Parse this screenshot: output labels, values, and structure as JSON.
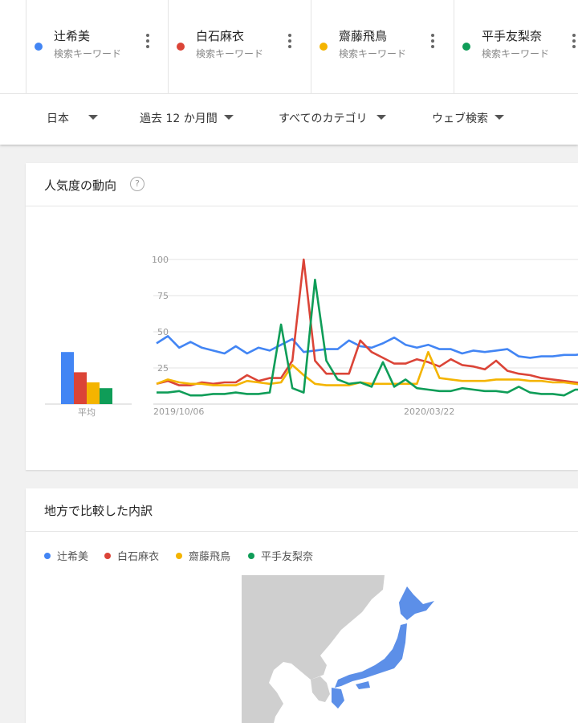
{
  "terms": [
    {
      "name": "辻希美",
      "sub": "検索キーワード",
      "color": "#4285f4"
    },
    {
      "name": "白石麻衣",
      "sub": "検索キーワード",
      "color": "#db4437"
    },
    {
      "name": "齋藤飛鳥",
      "sub": "検索キーワード",
      "color": "#f4b400"
    },
    {
      "name": "平手友梨奈",
      "sub": "検索キーワード",
      "color": "#0f9d58"
    }
  ],
  "filters": {
    "region": "日本",
    "period": "過去 12 か月間",
    "category": "すべてのカテゴリ",
    "search_type": "ウェブ検索"
  },
  "trend_card": {
    "title": "人気度の動向",
    "help_icon": "help-icon",
    "average_label": "平均"
  },
  "region_card": {
    "title": "地方で比較した内訳"
  },
  "chart_data": [
    {
      "type": "bar",
      "xlabel": "平均",
      "categories": [
        "辻希美",
        "白石麻衣",
        "齋藤飛鳥",
        "平手友梨奈"
      ],
      "values": [
        36,
        22,
        15,
        11
      ],
      "colors": [
        "#4285f4",
        "#db4437",
        "#f4b400",
        "#0f9d58"
      ]
    },
    {
      "type": "line",
      "ylim": [
        0,
        100
      ],
      "yticks": [
        25,
        50,
        75,
        100
      ],
      "xtick_labels": [
        "2019/10/06",
        "2020/03/22"
      ],
      "grid": true,
      "series": [
        {
          "name": "辻希美",
          "color": "#4285f4",
          "values": [
            42,
            47,
            39,
            43,
            39,
            37,
            35,
            40,
            35,
            39,
            37,
            41,
            45,
            36,
            37,
            38,
            38,
            44,
            40,
            39,
            42,
            46,
            41,
            39,
            41,
            38,
            38,
            35,
            37,
            36,
            37,
            38,
            33,
            32,
            33,
            33,
            34,
            34,
            35
          ]
        },
        {
          "name": "白石麻衣",
          "color": "#db4437",
          "values": [
            14,
            16,
            13,
            13,
            15,
            14,
            15,
            15,
            20,
            16,
            18,
            18,
            30,
            100,
            30,
            21,
            21,
            21,
            44,
            36,
            32,
            28,
            28,
            31,
            29,
            26,
            31,
            27,
            26,
            24,
            30,
            23,
            21,
            20,
            18,
            17,
            16,
            15,
            14
          ]
        },
        {
          "name": "齋藤飛鳥",
          "color": "#f4b400",
          "values": [
            14,
            17,
            15,
            14,
            14,
            13,
            13,
            13,
            16,
            15,
            14,
            15,
            27,
            20,
            14,
            13,
            13,
            13,
            15,
            14,
            14,
            14,
            14,
            14,
            36,
            18,
            17,
            16,
            16,
            16,
            17,
            17,
            17,
            16,
            16,
            15,
            15,
            14,
            13
          ]
        },
        {
          "name": "平手友梨奈",
          "color": "#0f9d58",
          "values": [
            8,
            8,
            9,
            6,
            6,
            7,
            7,
            8,
            7,
            7,
            8,
            55,
            11,
            8,
            86,
            30,
            17,
            14,
            15,
            12,
            29,
            12,
            17,
            11,
            10,
            9,
            9,
            11,
            10,
            9,
            9,
            8,
            12,
            8,
            7,
            7,
            6,
            10,
            10
          ]
        }
      ]
    }
  ]
}
